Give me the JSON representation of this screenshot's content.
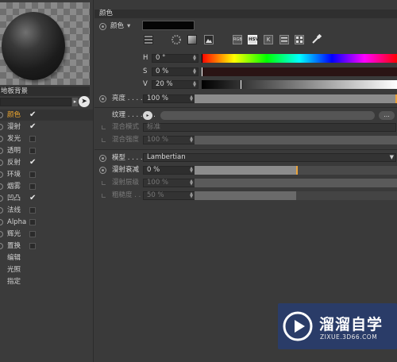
{
  "left": {
    "material_name": "地板背景",
    "channels": [
      {
        "label": "颜色",
        "checked": true,
        "active": true
      },
      {
        "label": "漫射",
        "checked": true
      },
      {
        "label": "发光",
        "checked": false
      },
      {
        "label": "透明",
        "checked": false
      },
      {
        "label": "反射",
        "checked": true
      },
      {
        "label": "环境",
        "checked": false
      },
      {
        "label": "烟雾",
        "checked": false
      },
      {
        "label": "凹凸",
        "checked": true
      },
      {
        "label": "法线",
        "checked": false
      },
      {
        "label": "Alpha",
        "checked": false
      },
      {
        "label": "辉光",
        "checked": false
      },
      {
        "label": "置换",
        "checked": false
      },
      {
        "label": "编辑"
      },
      {
        "label": "光照"
      },
      {
        "label": "指定"
      }
    ]
  },
  "color_section": {
    "header": "颜色",
    "color_label": "颜色",
    "color_value": "#050505",
    "mode_selected": "HSV",
    "h_label": "H",
    "h_value": "0 °",
    "h_level": 0,
    "s_label": "S",
    "s_value": "0 %",
    "s_level": 0,
    "v_label": "V",
    "v_value": "20 %",
    "v_level": 0.2,
    "brightness_label": "亮度 . . . . .",
    "brightness_value": "100 %",
    "brightness_level": 1.0,
    "texture_label": "纹理 . . . . . . .",
    "texture_more": "...",
    "blend_mode_label": "混合模式",
    "blend_mode_value": "标准",
    "blend_strength_label": "混合强度",
    "blend_strength_value": "100 %"
  },
  "model_section": {
    "model_label": "模型 . . . . . .",
    "model_value": "Lambertian",
    "diffuse_falloff_label": "漫射衰减",
    "diffuse_falloff_value": "0 %",
    "diffuse_falloff_level": 0.5,
    "diffuse_level_label": "漫射层级",
    "diffuse_level_value": "100 %",
    "roughness_label": "粗糙度 . . . .",
    "roughness_value": "50 %",
    "roughness_level": 0.5
  },
  "watermark": {
    "brand": "溜溜自学",
    "url": "ZIXUE.3D66.COM"
  }
}
